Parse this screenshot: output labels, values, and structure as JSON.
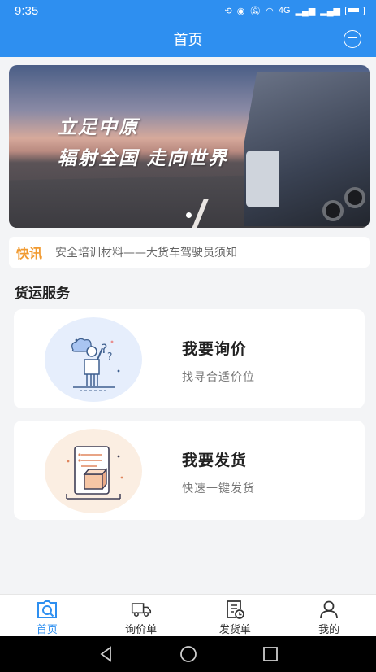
{
  "status_bar": {
    "time": "9:35",
    "network": "4G"
  },
  "app_bar": {
    "title": "首页",
    "message_icon": "message-icon"
  },
  "banner": {
    "line1": "立足中原",
    "line2": "辐射全国  走向世界",
    "slides": 1,
    "active_slide": 1
  },
  "news": {
    "tag": "快讯",
    "text": "安全培训材料——大货车驾驶员须知"
  },
  "section": {
    "title": "货运服务"
  },
  "services": [
    {
      "title": "我要询价",
      "subtitle": "找寻合适价位",
      "icon": "inquiry-illustration"
    },
    {
      "title": "我要发货",
      "subtitle": "快速一键发货",
      "icon": "shipment-illustration"
    }
  ],
  "tabs": [
    {
      "label": "首页",
      "icon": "home-icon",
      "active": true
    },
    {
      "label": "询价单",
      "icon": "truck-icon",
      "active": false
    },
    {
      "label": "发货单",
      "icon": "bill-clock-icon",
      "active": false
    },
    {
      "label": "我的",
      "icon": "user-icon",
      "active": false
    }
  ],
  "colors": {
    "primary": "#2e8ff0",
    "news_tag": "#f19a30"
  }
}
